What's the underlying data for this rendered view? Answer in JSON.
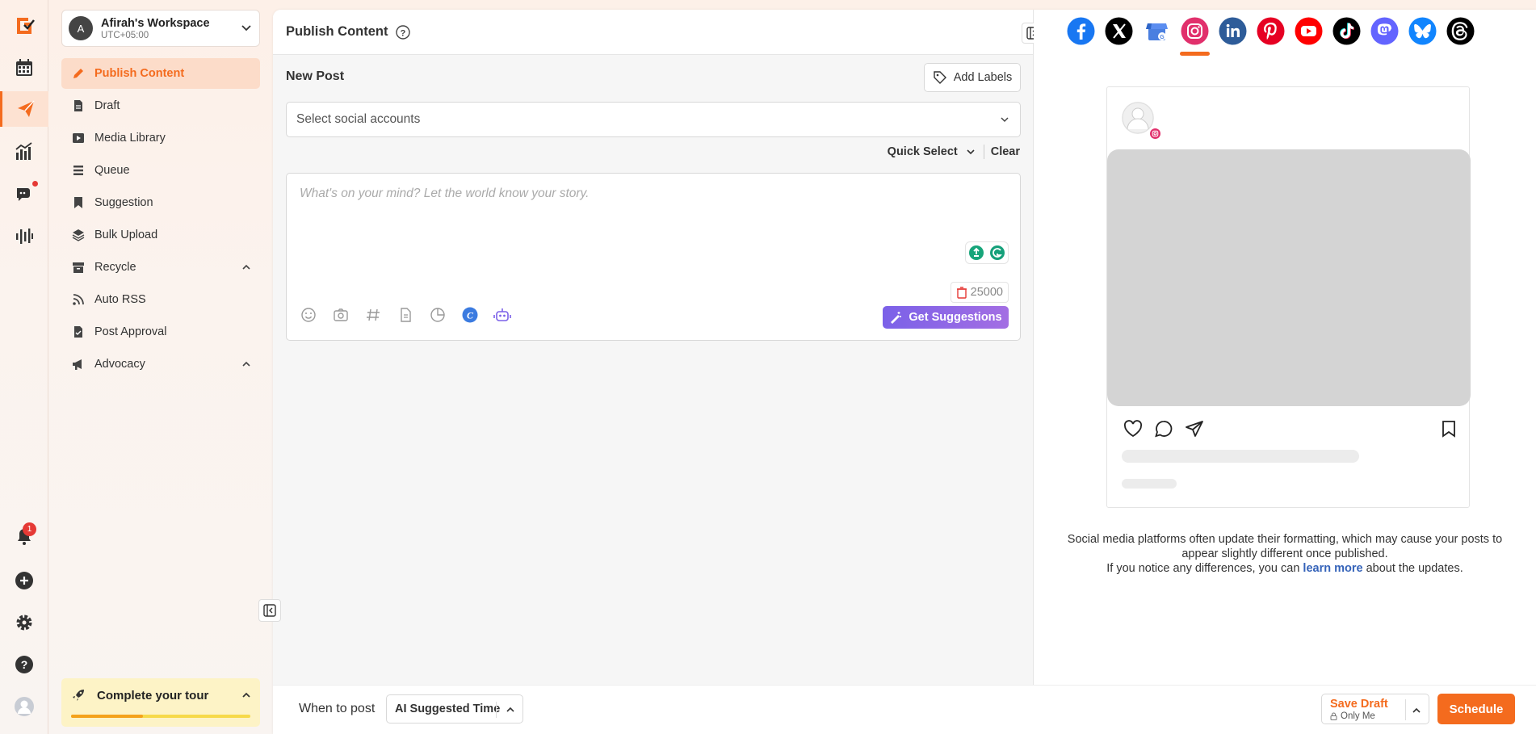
{
  "app": {
    "brand_color": "#f46b1e"
  },
  "rail": {
    "items": [
      "logo-icon",
      "calendar-icon",
      "publish-icon",
      "analytics-icon",
      "inbox-icon",
      "listening-icon"
    ],
    "bottom": [
      "bell-icon",
      "plus-circle-icon",
      "gear-icon",
      "help-icon",
      "user-avatar"
    ],
    "notification_count": "1"
  },
  "workspace": {
    "avatar_letter": "A",
    "name": "Afirah's Workspace",
    "timezone": "UTC+05:00"
  },
  "sidebar": {
    "items": [
      {
        "label": "Publish Content",
        "icon": "pencil-icon"
      },
      {
        "label": "Draft",
        "icon": "document-icon"
      },
      {
        "label": "Media Library",
        "icon": "media-icon"
      },
      {
        "label": "Queue",
        "icon": "queue-icon"
      },
      {
        "label": "Suggestion",
        "icon": "bookmark-icon"
      },
      {
        "label": "Bulk Upload",
        "icon": "layers-icon"
      },
      {
        "label": "Recycle",
        "icon": "archive-icon"
      },
      {
        "label": "Auto RSS",
        "icon": "rss-icon"
      },
      {
        "label": "Post Approval",
        "icon": "approval-icon"
      },
      {
        "label": "Advocacy",
        "icon": "megaphone-icon"
      }
    ],
    "tour": {
      "title": "Complete your tour",
      "progress": 0.4
    }
  },
  "composer": {
    "title": "Publish Content",
    "new_post": "New Post",
    "add_labels": "Add Labels",
    "accounts_placeholder": "Select social accounts",
    "quick_select": "Quick Select",
    "clear": "Clear",
    "editor_placeholder": "What's on your mind? Let the world know your story.",
    "char_limit": "25000",
    "get_suggestions": "Get Suggestions"
  },
  "preview": {
    "platforms": [
      "facebook",
      "x",
      "google-business",
      "instagram",
      "linkedin",
      "pinterest",
      "youtube",
      "tiktok",
      "mastodon",
      "bluesky",
      "threads"
    ],
    "active_platform": "instagram",
    "disclaimer_line1": "Social media platforms often update their formatting, which may cause your posts to appear slightly different once published.",
    "disclaimer_line2_pre": "If you notice any differences, you can",
    "disclaimer_link": "learn more",
    "disclaimer_line2_post": "about the updates."
  },
  "footer": {
    "when_label": "When to post",
    "when_value": "AI Suggested Time",
    "save_draft": "Save Draft",
    "visibility": "Only Me",
    "schedule": "Schedule"
  }
}
